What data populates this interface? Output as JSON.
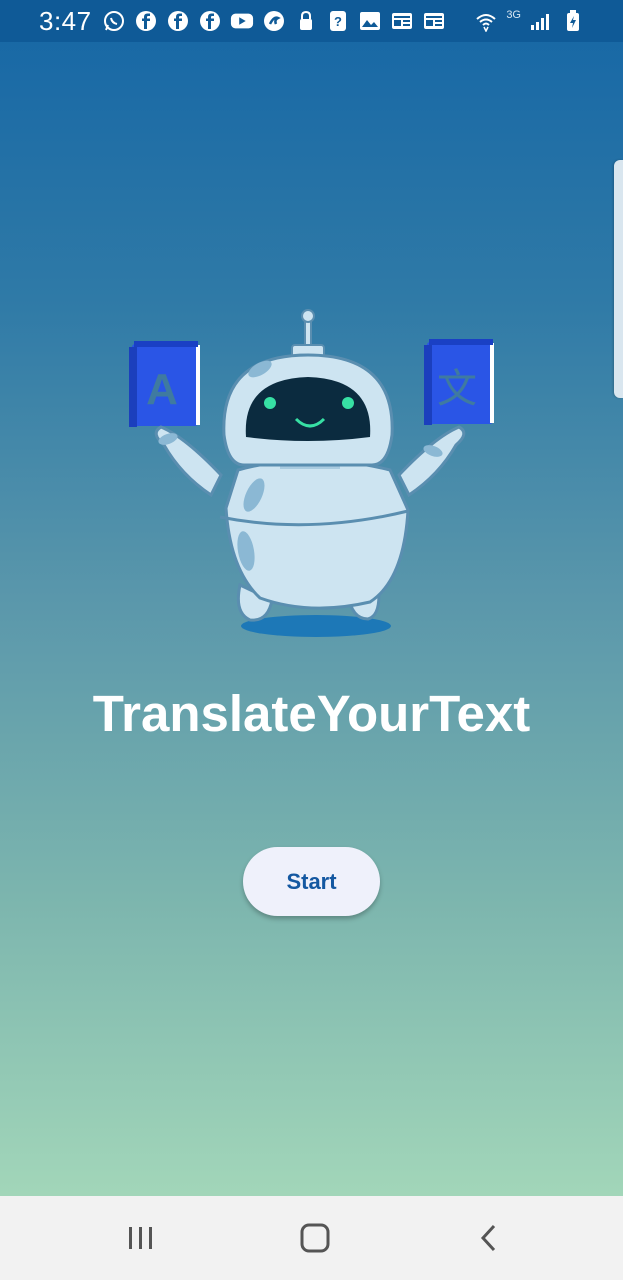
{
  "status_bar": {
    "time": "3:47",
    "network_label": "3G",
    "notification_icons": [
      "whatsapp-icon",
      "facebook-icon",
      "facebook-icon",
      "facebook-icon",
      "youtube-icon",
      "app-icon",
      "lock-icon",
      "help-icon",
      "image-icon",
      "news-icon",
      "news-icon"
    ],
    "status_icons": [
      "wifi-icon",
      "signal-icon",
      "battery-charging-icon"
    ]
  },
  "main": {
    "title": "TranslateYourText",
    "start_label": "Start",
    "illustration": {
      "left_book_glyph": "A",
      "right_book_glyph": "文"
    }
  },
  "nav_bar": {
    "buttons": [
      "recent-apps-icon",
      "home-icon",
      "back-icon"
    ]
  },
  "colors": {
    "gradient_top": "#1566a5",
    "gradient_bottom": "#a2d6b9",
    "button_bg": "#eff1fb",
    "button_text": "#1458a1",
    "book_blue": "#2a55e6",
    "robot_body": "#cde4f1"
  }
}
